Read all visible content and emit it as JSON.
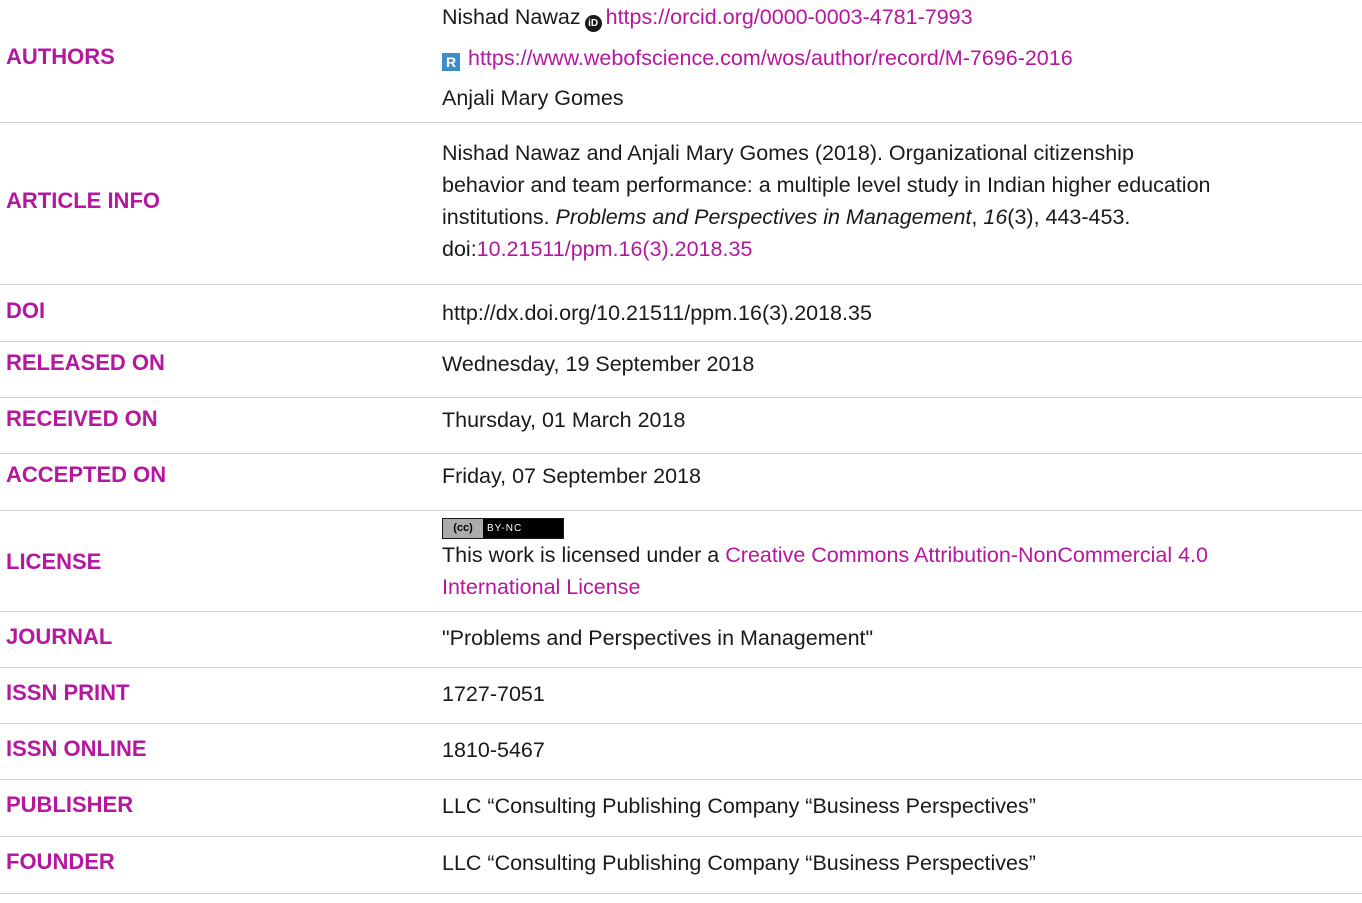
{
  "rows": {
    "authors": {
      "label": "AUTHORS",
      "author1_name": "Nishad Nawaz",
      "author1_orcid_url": "https://orcid.org/0000-0003-4781-7993",
      "author1_wos_url": "https://www.webofscience.com/wos/author/record/M-7696-2016",
      "author2_name": "Anjali Mary Gomes",
      "orcid_icon": "orcid-icon",
      "wos_icon": "researcherid-icon"
    },
    "article_info": {
      "label": "ARTICLE INFO",
      "line1": "Nishad Nawaz and Anjali Mary Gomes (2018). Organizational citizenship",
      "line2": "behavior and team performance: a multiple level study in Indian higher education",
      "line3_prefix": "institutions. ",
      "journal_italic": "Problems and Perspectives in Management",
      "comma": ", ",
      "volume_italic": "16",
      "issue_pages": "(3), 443-453.",
      "doi_prefix": "doi:",
      "doi_link": "10.21511/ppm.16(3).2018.35"
    },
    "doi": {
      "label": "DOI",
      "value": "http://dx.doi.org/10.21511/ppm.16(3).2018.35"
    },
    "released_on": {
      "label": "RELEASED ON",
      "value": "Wednesday, 19 September 2018"
    },
    "received_on": {
      "label": "RECEIVED ON",
      "value": "Thursday, 01 March 2018"
    },
    "accepted_on": {
      "label": "ACCEPTED ON",
      "value": "Friday, 07 September 2018"
    },
    "license": {
      "label": "LICENSE",
      "badge_left": "(cc)",
      "badge_right": "BY-NC",
      "text_prefix": "This work is licensed under a ",
      "link_line1": "Creative Commons Attribution-NonCommercial 4.0",
      "link_line2": "International License"
    },
    "journal": {
      "label": "JOURNAL",
      "value": "\"Problems and Perspectives in Management\""
    },
    "issn_print": {
      "label": "ISSN PRINT",
      "value": "1727-7051"
    },
    "issn_online": {
      "label": "ISSN ONLINE",
      "value": "1810-5467"
    },
    "publisher": {
      "label": "PUBLISHER",
      "value": "LLC “Consulting Publishing Company “Business Perspectives”"
    },
    "founder": {
      "label": "FOUNDER",
      "value": "LLC “Consulting Publishing Company “Business Perspectives”"
    }
  },
  "colors": {
    "accent": "#b5179e",
    "text": "#1a1a1a",
    "divider": "#cfcfcf"
  }
}
